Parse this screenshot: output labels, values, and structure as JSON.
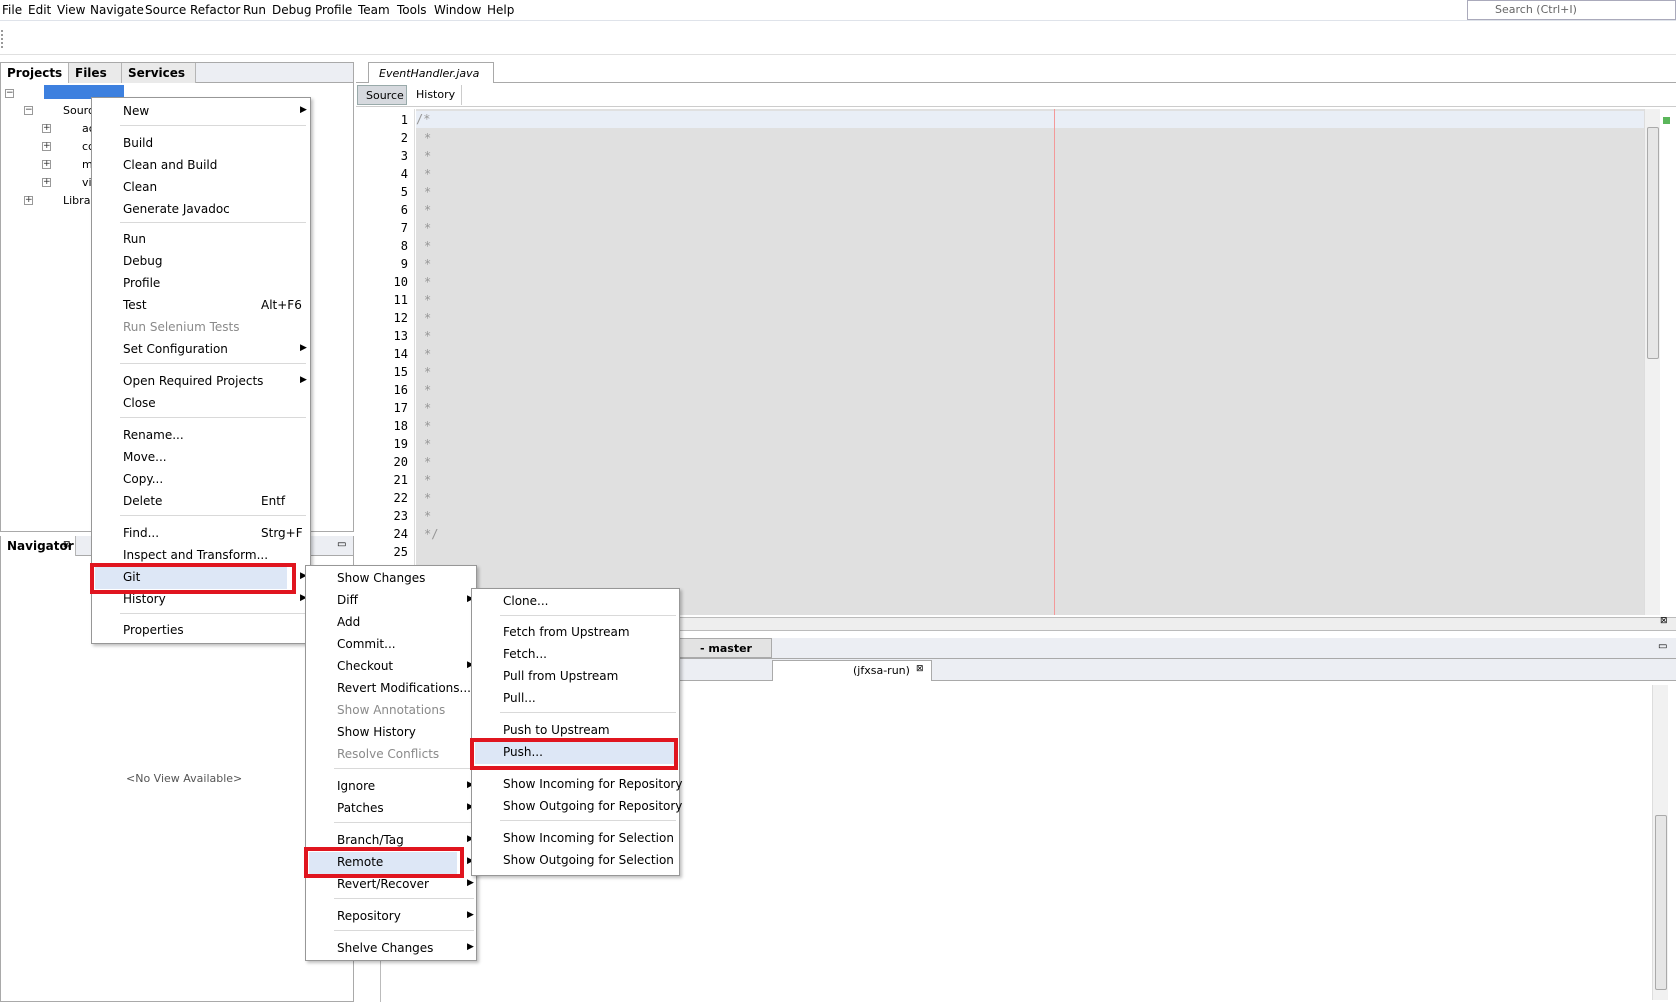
{
  "menubar": {
    "items": [
      "File",
      "Edit",
      "View",
      "Navigate",
      "Source",
      "Refactor",
      "Run",
      "Debug",
      "Profile",
      "Team",
      "Tools",
      "Window",
      "Help"
    ],
    "search_placeholder": "Search (Ctrl+I)"
  },
  "projects_panel": {
    "tabs": [
      "Projects",
      "Files",
      "Services"
    ],
    "tree": [
      "Sourc",
      "ac",
      "cc",
      "m",
      "vi",
      "Librar"
    ]
  },
  "navigator": {
    "title": "Navigator",
    "empty_text": "<No View Available>"
  },
  "editor": {
    "file_tab": "EventHandler.java",
    "view_tabs": [
      "Source",
      "History"
    ],
    "line_numbers": [
      "1",
      "2",
      "3",
      "4",
      "5",
      "6",
      "7",
      "8",
      "9",
      "10",
      "11",
      "12",
      "13",
      "14",
      "15",
      "16",
      "17",
      "18",
      "19",
      "20",
      "21",
      "22",
      "23",
      "24",
      "25"
    ],
    "first_line": "/*",
    "mid_line": "*",
    "last_line": "*/"
  },
  "output": {
    "git_tab": "- master",
    "run_tab": "(jfxsa-run)"
  },
  "context_menu": {
    "items": [
      {
        "label": "New",
        "submenu": true
      },
      {
        "label": "Build"
      },
      {
        "label": "Clean and Build"
      },
      {
        "label": "Clean"
      },
      {
        "label": "Generate Javadoc"
      },
      {
        "label": "Run"
      },
      {
        "label": "Debug"
      },
      {
        "label": "Profile"
      },
      {
        "label": "Test",
        "shortcut": "Alt+F6"
      },
      {
        "label": "Run Selenium Tests",
        "disabled": true
      },
      {
        "label": "Set Configuration",
        "submenu": true
      },
      {
        "label": "Open Required Projects",
        "submenu": true
      },
      {
        "label": "Close"
      },
      {
        "label": "Rename..."
      },
      {
        "label": "Move..."
      },
      {
        "label": "Copy..."
      },
      {
        "label": "Delete",
        "shortcut": "Entf"
      },
      {
        "label": "Find...",
        "shortcut": "Strg+F"
      },
      {
        "label": "Inspect and Transform..."
      },
      {
        "label": "Git",
        "submenu": true,
        "highlighted": true
      },
      {
        "label": "History",
        "submenu": true
      },
      {
        "label": "Properties"
      }
    ]
  },
  "git_menu": {
    "items": [
      {
        "label": "Show Changes"
      },
      {
        "label": "Diff",
        "submenu": true
      },
      {
        "label": "Add"
      },
      {
        "label": "Commit..."
      },
      {
        "label": "Checkout",
        "submenu": true
      },
      {
        "label": "Revert Modifications..."
      },
      {
        "label": "Show Annotations",
        "disabled": true
      },
      {
        "label": "Show History"
      },
      {
        "label": "Resolve Conflicts",
        "disabled": true
      },
      {
        "label": "Ignore",
        "submenu": true
      },
      {
        "label": "Patches",
        "submenu": true
      },
      {
        "label": "Branch/Tag",
        "submenu": true
      },
      {
        "label": "Remote",
        "submenu": true,
        "highlighted": true
      },
      {
        "label": "Revert/Recover",
        "submenu": true
      },
      {
        "label": "Repository",
        "submenu": true
      },
      {
        "label": "Shelve Changes",
        "submenu": true
      }
    ]
  },
  "remote_menu": {
    "items": [
      {
        "label": "Clone..."
      },
      {
        "label": "Fetch from Upstream"
      },
      {
        "label": "Fetch..."
      },
      {
        "label": "Pull from Upstream"
      },
      {
        "label": "Pull..."
      },
      {
        "label": "Push to Upstream"
      },
      {
        "label": "Push...",
        "highlighted": true
      },
      {
        "label": "Show Incoming for Repository"
      },
      {
        "label": "Show Outgoing for Repository"
      },
      {
        "label": "Show Incoming for Selection"
      },
      {
        "label": "Show Outgoing for Selection"
      }
    ]
  },
  "colors": {
    "highlight_box": "#e0151f",
    "selection": "#3d80df",
    "accent_bg": "#dde7f6"
  }
}
